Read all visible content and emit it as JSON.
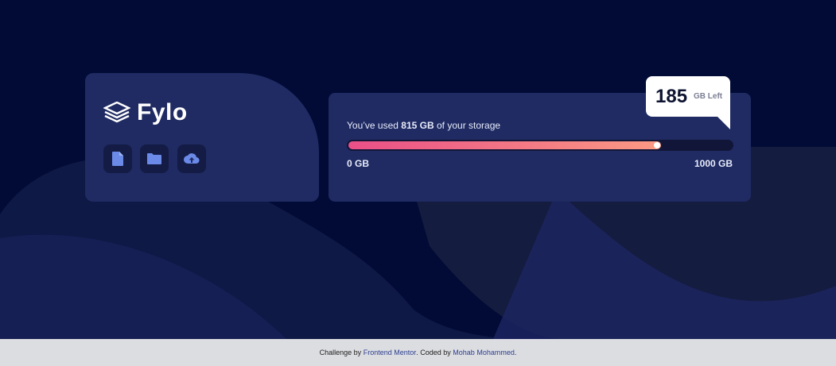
{
  "brand": {
    "name": "Fylo"
  },
  "toolbar": {
    "icons": [
      "document-icon",
      "folder-icon",
      "upload-icon"
    ]
  },
  "storage": {
    "prefix": "You’ve used",
    "used": "815 GB",
    "suffix": "of your storage",
    "used_fraction": 0.815,
    "min_label": "0 GB",
    "max_label": "1000 GB",
    "remaining": "185",
    "remaining_label": "GB Left"
  },
  "footer": {
    "prefix": "Challenge by",
    "link1": "Frontend Mentor",
    "middle": ". Coded by",
    "link2": "Mohab Mohammed",
    "end": "."
  },
  "colors": {
    "background": "#020b36",
    "card": "#1f2b62",
    "gradient_start": "#ea4f87",
    "gradient_end": "#fb9a83"
  }
}
